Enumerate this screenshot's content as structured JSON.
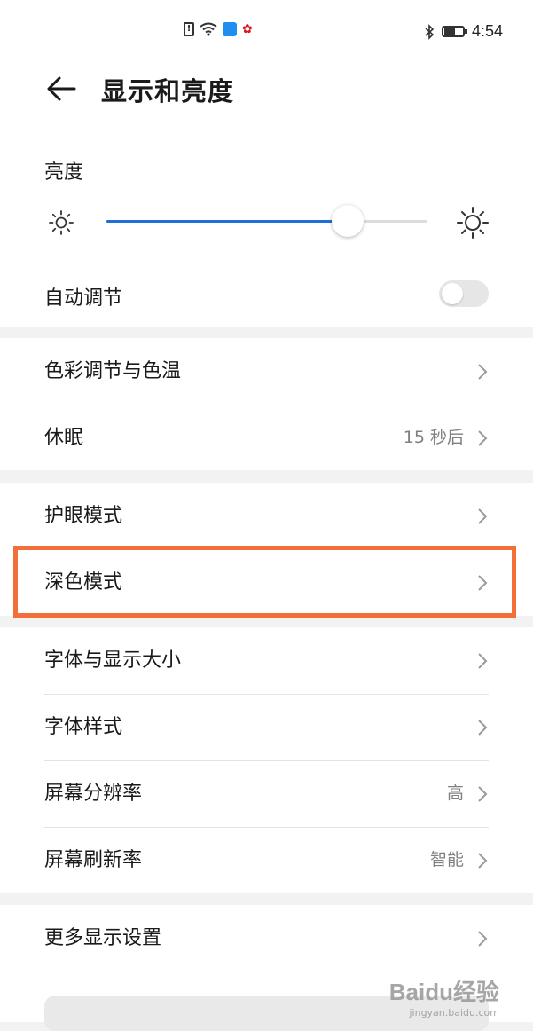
{
  "status_bar": {
    "time": "4:54",
    "sim_badge": "!"
  },
  "header": {
    "title": "显示和亮度"
  },
  "brightness": {
    "label": "亮度",
    "level_percent": 75,
    "auto_label": "自动调节",
    "auto_enabled": false
  },
  "group_color": {
    "items": [
      {
        "label": "色彩调节与色温",
        "value": ""
      },
      {
        "label": "休眠",
        "value": "15 秒后"
      }
    ]
  },
  "group_mode": {
    "items": [
      {
        "label": "护眼模式",
        "value": ""
      },
      {
        "label": "深色模式",
        "value": ""
      }
    ]
  },
  "group_font": {
    "items": [
      {
        "label": "字体与显示大小",
        "value": ""
      },
      {
        "label": "字体样式",
        "value": ""
      },
      {
        "label": "屏幕分辨率",
        "value": "高"
      },
      {
        "label": "屏幕刷新率",
        "value": "智能"
      }
    ]
  },
  "group_more": {
    "items": [
      {
        "label": "更多显示设置",
        "value": ""
      }
    ]
  },
  "highlight": {
    "target": "深色模式",
    "color": "#f26f3a"
  },
  "colors": {
    "accent": "#1f6fd6",
    "background": "#f2f2f2",
    "card": "#ffffff"
  },
  "watermark": {
    "logo": "Baidu经验",
    "url": "jingyan.baidu.com"
  }
}
